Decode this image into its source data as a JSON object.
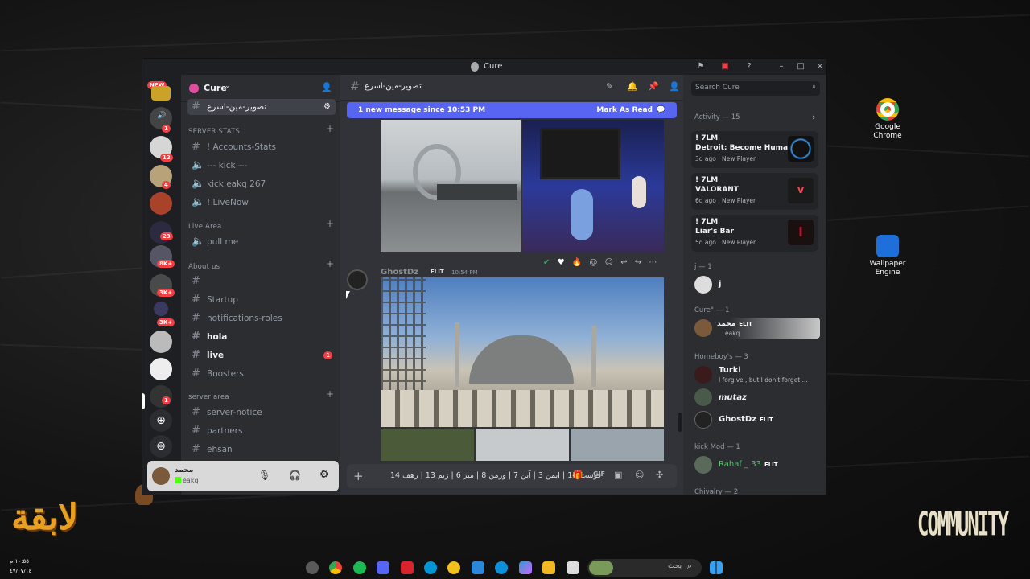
{
  "desktop": {
    "icons": [
      {
        "label_line1": "Google",
        "label_line2": "Chrome"
      },
      {
        "label_line1": "Wallpaper",
        "label_line2": "Engine"
      }
    ],
    "watermark_right": "COMMUNITY",
    "watermark_left": "لابقة",
    "clock_time": "١٠:٥٥ م",
    "clock_date": "٤٧/٠٧/١٤"
  },
  "window": {
    "title": "Cure"
  },
  "rail": {
    "new_badge": "NEW",
    "badges": [
      "1",
      "12",
      "4",
      "23",
      "8K+",
      "3K+",
      "3K+",
      "1"
    ]
  },
  "server": {
    "name": "Cure",
    "selected_channel": "تصوير-مين-اسرع",
    "categories": [
      {
        "title": "SERVER STATS",
        "channels": [
          "! Accounts-Stats",
          "--- kick ---",
          "kick eakq 267",
          "! LiveNow"
        ]
      },
      {
        "title": "Live Area",
        "channels": [
          "pull me"
        ]
      },
      {
        "title": "About us",
        "channels": [
          "",
          "Startup",
          "notifications-roles",
          "hola",
          "live",
          "Boosters"
        ]
      },
      {
        "title": "server area",
        "channels": [
          "server-notice",
          "partners",
          "ehsan"
        ]
      }
    ],
    "live_badge": "1"
  },
  "user_panel": {
    "name": "محمد",
    "status": "eakq"
  },
  "chat": {
    "channel_name": "تصوير-مين-اسرع",
    "new_messages_text": "1 new message since 10:53 PM",
    "mark_as_read": "Mark As Read",
    "author": "GhostDz",
    "author_tag": "ELIT",
    "timestamp": "10:54 PM",
    "composer_text": "قوست 14 | ايمن 3 | آين 7 | ورمن 8 | ميز 6 | زيم 13 | رهف 14"
  },
  "search": {
    "placeholder": "Search Cure"
  },
  "members": {
    "activity_header": "Activity — 15",
    "activities": [
      {
        "user": "! 7LM",
        "game": "Detroit: Become Human",
        "time": "3d ago",
        "tag": "New Player"
      },
      {
        "user": "! 7LM",
        "game": "VALORANT",
        "time": "6d ago",
        "tag": "New Player"
      },
      {
        "user": "! 7LM",
        "game": "Liar's Bar",
        "time": "5d ago",
        "tag": "New Player"
      }
    ],
    "groups": [
      {
        "title": "j — 1",
        "members": [
          {
            "name": "j",
            "sub": ""
          }
        ]
      },
      {
        "title": "Cure° — 1",
        "members": [
          {
            "name": "محمد",
            "tag": "ELIT",
            "sub": "eakq"
          }
        ]
      },
      {
        "title": "Homeboy's — 3",
        "members": [
          {
            "name": "Turki",
            "sub": "I forgive , but I don't forget ..."
          },
          {
            "name": "mutaz",
            "sub": ""
          },
          {
            "name": "GhostDz",
            "tag": "ELIT",
            "sub": ""
          }
        ]
      },
      {
        "title": "kick Mod — 1",
        "members": [
          {
            "name": "Rahaf _ 33",
            "tag": "ELIT",
            "sub": ""
          }
        ]
      },
      {
        "title": "Chivalry — 2",
        "members": []
      }
    ]
  },
  "taskbar": {
    "search_placeholder": "بحث"
  }
}
